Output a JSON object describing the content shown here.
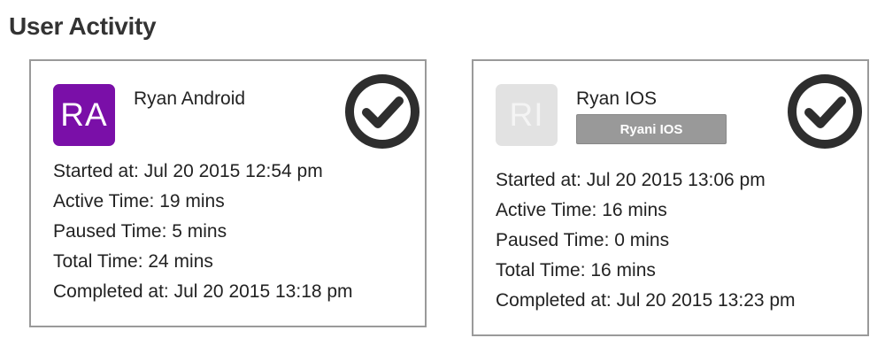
{
  "page": {
    "title": "User Activity"
  },
  "cards": [
    {
      "avatar_initials": "RA",
      "avatar_color": "#7a0fa8",
      "name": "Ryan Android",
      "badge": "",
      "status_icon": "check-circle-icon",
      "details": [
        "Started at: Jul 20 2015 12:54 pm",
        "Active Time: 19 mins",
        "Paused Time: 5 mins",
        "Total Time: 24 mins",
        "Completed at: Jul 20 2015 13:18 pm"
      ]
    },
    {
      "avatar_initials": "RI",
      "avatar_color": "#e2e2e2",
      "name": "Ryan IOS",
      "badge": "Ryani IOS",
      "status_icon": "check-circle-icon",
      "details": [
        "Started at: Jul 20 2015 13:06 pm",
        "Active Time: 16 mins",
        "Paused Time: 0 mins",
        "Total Time: 16 mins",
        "Completed at: Jul 20 2015 13:23 pm"
      ]
    }
  ]
}
